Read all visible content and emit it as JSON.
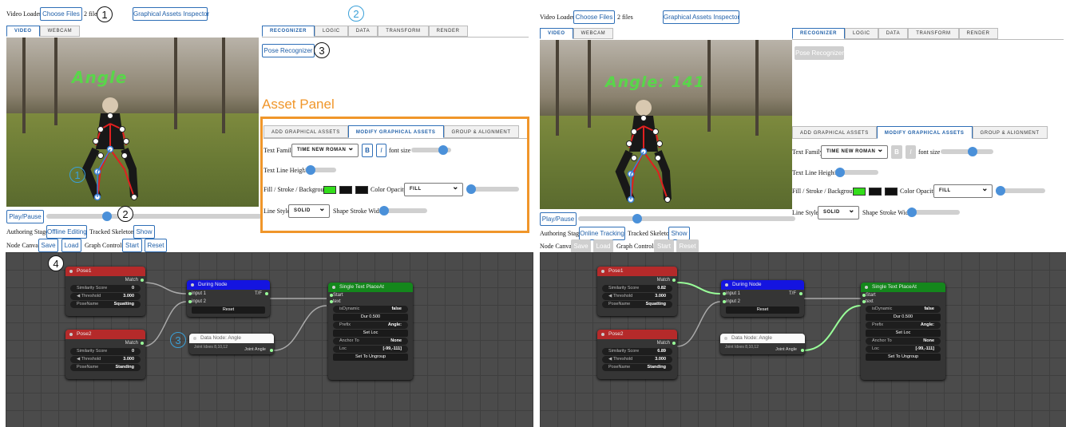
{
  "top": {
    "video_loader_label": "Video Loader:",
    "choose_files": "Choose Files",
    "files_count": "2 files",
    "assets_inspector": "Graphical Assets Inspector"
  },
  "video_tabs": [
    "VIDEO",
    "WEBCAM"
  ],
  "main_tabs": [
    "RECOGNIZER",
    "LOGIC",
    "DATA",
    "TRANSFORM",
    "RENDER"
  ],
  "pose_recognizer": "Pose Recognizer",
  "asset_panel_title": "Asset Panel",
  "asset_tabs": [
    "ADD GRAPHICAL ASSETS",
    "MODIFY GRAPHICAL ASSETS",
    "GROUP & ALIGNMENT"
  ],
  "asset": {
    "text_family": "Text Family",
    "font_select": "TIME NEW ROMAN",
    "bold": "B",
    "italic": "I",
    "font_size": "font size",
    "line_height": "Text Line Height",
    "fill_label": "Fill / Stroke / Background",
    "color_opacity": "Color Opacity",
    "fill_select": "FILL",
    "line_style": "Line Style",
    "solid_select": "SOLID",
    "shape_stroke": "Shape Stroke Width"
  },
  "controls": {
    "play_pause": "Play/Pause",
    "authoring_stage": "Authoring Stage",
    "tracked_skeleton": "Tracked Skeleton",
    "show": "Show",
    "node_canvas": "Node Canvas",
    "save": "Save",
    "load": "Load",
    "graph_controls": "Graph Controls",
    "start": "Start",
    "reset": "Reset"
  },
  "left": {
    "stage_mode": "Offline Editing",
    "angle_text": "Angle",
    "pose1": {
      "score": "0",
      "threshold": "3.000"
    },
    "pose2": {
      "score": "0",
      "threshold": "3.000"
    }
  },
  "right": {
    "stage_mode": "Online Tracking",
    "angle_text": "Angle: 141",
    "pose1": {
      "score": "0.82",
      "threshold": "3.000"
    },
    "pose2": {
      "score": "6.89",
      "threshold": "3.000"
    }
  },
  "nodes": {
    "pose1_title": "Pose1",
    "pose2_title": "Pose2",
    "match": "Match",
    "similarity": "Similarity Score",
    "threshold": "Threshold",
    "posename": "PoseName",
    "pose1_name": "Squatting",
    "pose2_name": "Standing",
    "during_title": "During Node",
    "input1": "input 1",
    "input2": "input 2",
    "tf": "T/F",
    "reset": "Reset",
    "data_title": "Data Node: Angle",
    "joint_desc": "Joint Idxes 8,10,12",
    "joint_angle": "Joint Angle",
    "single_title": "Single Text PlaceAt",
    "start": "Start",
    "text": "text",
    "isdynamic": "isDynamic",
    "false": "false",
    "dur": "Dur 0.500",
    "prefix": "Prefix",
    "prefix_val": "Angle:",
    "set_loc": "Set Loc",
    "anchor": "Anchor To",
    "none": "None",
    "loc": "Loc",
    "loc_val": "[-99,-111]",
    "ungroup": "Set To Ungroup"
  },
  "annotations": [
    "1",
    "2",
    "3",
    "4"
  ],
  "colors": {
    "accent": "#1f5fa8",
    "asset_border": "#f0962a",
    "pose_red": "#b52a2a",
    "during_blue": "#1414e0",
    "single_green": "#14871c",
    "canvas": "#4b4b4b"
  }
}
